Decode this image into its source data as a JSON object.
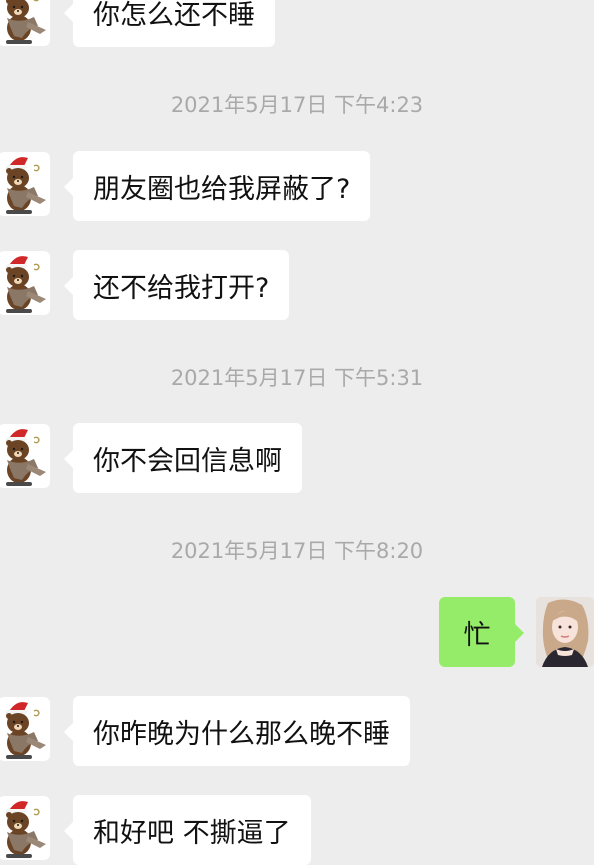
{
  "colors": {
    "background": "#ededed",
    "incoming_bubble": "#ffffff",
    "outgoing_bubble": "#95ec69",
    "timestamp_text": "#a9a9a9"
  },
  "timestamps": [
    "2021年5月17日 下午4:23",
    "2021年5月17日 下午5:31",
    "2021年5月17日 下午8:20"
  ],
  "messages": [
    {
      "sender": "contact",
      "avatar_icon": "brown-bear-santa-hat-icon",
      "text": "你怎么还不睡"
    },
    {
      "sender": "contact",
      "avatar_icon": "brown-bear-santa-hat-icon",
      "text": "朋友圈也给我屏蔽了?"
    },
    {
      "sender": "contact",
      "avatar_icon": "brown-bear-santa-hat-icon",
      "text": "还不给我打开?"
    },
    {
      "sender": "contact",
      "avatar_icon": "brown-bear-santa-hat-icon",
      "text": "你不会回信息啊"
    },
    {
      "sender": "me",
      "avatar_icon": "girl-profile-photo",
      "text": "忙"
    },
    {
      "sender": "contact",
      "avatar_icon": "brown-bear-santa-hat-icon",
      "text": "你昨晚为什么那么晚不睡"
    },
    {
      "sender": "contact",
      "avatar_icon": "brown-bear-santa-hat-icon",
      "text": "和好吧 不撕逼了"
    }
  ]
}
